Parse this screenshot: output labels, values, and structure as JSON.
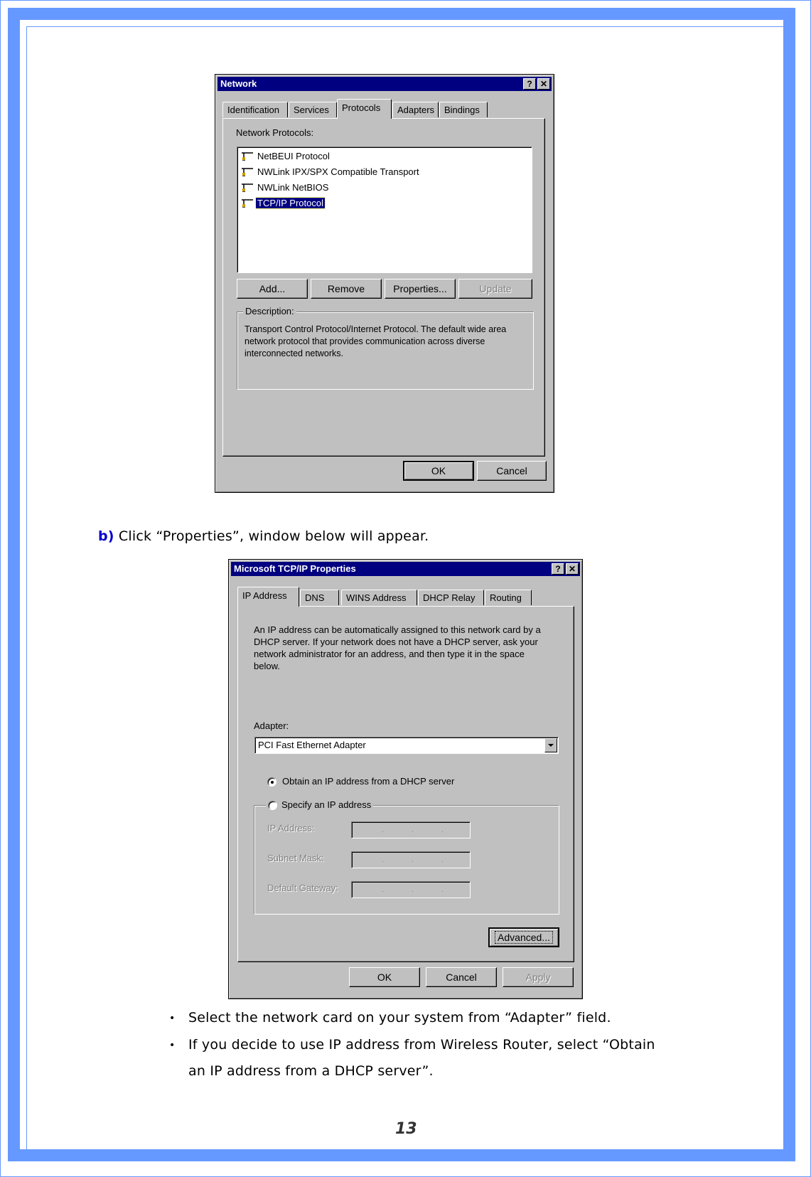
{
  "page": {
    "number": "13",
    "frame_color": "#6699ff"
  },
  "network_dialog": {
    "title": "Network",
    "help_button": "?",
    "close_button": "✕",
    "tabs": [
      {
        "label": "Identification",
        "active": false
      },
      {
        "label": "Services",
        "active": false
      },
      {
        "label": "Protocols",
        "active": true
      },
      {
        "label": "Adapters",
        "active": false
      },
      {
        "label": "Bindings",
        "active": false
      }
    ],
    "list_label": "Network Protocols:",
    "protocols": [
      {
        "label": "NetBEUI Protocol",
        "icon": "network-protocol-icon",
        "selected": false
      },
      {
        "label": "NWLink IPX/SPX Compatible Transport",
        "icon": "network-protocol-icon",
        "selected": false
      },
      {
        "label": "NWLink NetBIOS",
        "icon": "network-protocol-icon",
        "selected": false
      },
      {
        "label": "TCP/IP Protocol",
        "icon": "network-protocol-icon",
        "selected": true
      }
    ],
    "buttons": {
      "add": "Add...",
      "remove": "Remove",
      "properties": "Properties...",
      "update": "Update"
    },
    "description_label": "Description:",
    "description_text": "Transport Control Protocol/Internet Protocol. The default wide area network protocol that provides communication across diverse interconnected networks.",
    "ok": "OK",
    "cancel": "Cancel"
  },
  "step_b": {
    "label": "b)",
    "text": " Click “Properties”, window below will appear."
  },
  "tcpip_dialog": {
    "title": "Microsoft TCP/IP Properties",
    "help_button": "?",
    "close_button": "✕",
    "tabs": [
      {
        "label": "IP Address",
        "active": true
      },
      {
        "label": "DNS",
        "active": false
      },
      {
        "label": "WINS Address",
        "active": false
      },
      {
        "label": "DHCP Relay",
        "active": false
      },
      {
        "label": "Routing",
        "active": false
      }
    ],
    "intro_text": "An IP address can be automatically assigned to this network card by a DHCP server.  If your network does not have a DHCP server, ask your network administrator for an address, and then type it in the space below.",
    "adapter_label": "Adapter:",
    "adapter_value": "PCI Fast Ethernet Adapter",
    "radio_dhcp": {
      "label": "Obtain an IP address from a DHCP server",
      "checked": true
    },
    "radio_specify": {
      "label": "Specify an IP address",
      "checked": false
    },
    "ip_address_label": "IP Address:",
    "subnet_mask_label": "Subnet Mask:",
    "default_gateway_label": "Default Gateway:",
    "ip_dot": ".",
    "advanced": "Advanced...",
    "ok": "OK",
    "cancel": "Cancel",
    "apply": "Apply"
  },
  "bullets": [
    {
      "text": "Select the network card on your system from “Adapter” field."
    },
    {
      "text": "If you decide to use IP address from Wireless Router, select “Obtain",
      "continuation": "an IP address from a DHCP server”."
    }
  ],
  "bullet_glyph": "•"
}
